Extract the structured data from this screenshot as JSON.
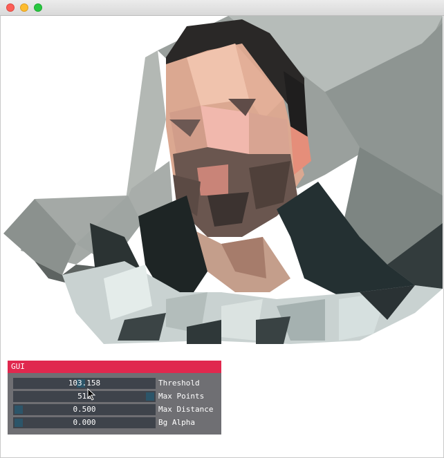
{
  "window": {
    "traffic_lights": [
      "close",
      "minimize",
      "maximize"
    ]
  },
  "canvas": {
    "content": "low-poly portrait",
    "background": "#ffffff"
  },
  "gui": {
    "title": "GUI",
    "accent": "#e0284e",
    "params": [
      {
        "label": "Threshold",
        "value": "103.158",
        "fill": 0.45
      },
      {
        "label": "Max Points",
        "value": "512",
        "fill": 1.0
      },
      {
        "label": "Max Distance",
        "value": "0.500",
        "fill": 0.0
      },
      {
        "label": "Bg Alpha",
        "value": "0.000",
        "fill": 0.0
      }
    ]
  },
  "cursor": {
    "icon": "arrow-cursor-icon"
  }
}
